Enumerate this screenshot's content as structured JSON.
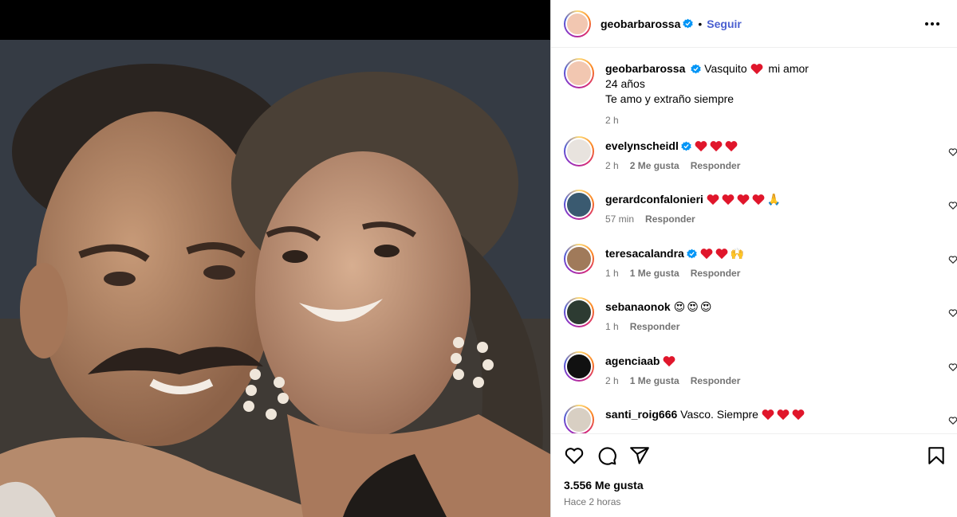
{
  "post": {
    "author": "geobarbarossa",
    "follow_label": "Seguir",
    "separator": "•"
  },
  "caption": {
    "author": "geobarbarossa",
    "line1_a": "Vasquito",
    "line1_b": "mi amor",
    "line2": "24 años",
    "line3": "Te amo y extraño siempre",
    "time": "2 h"
  },
  "comments": [
    {
      "user": "evelynscheidl",
      "verified": true,
      "text": "",
      "hearts": 3,
      "extra_emoji": [],
      "time": "2 h",
      "likes": "2 Me gusta",
      "reply": "Responder"
    },
    {
      "user": "gerardconfalonieri",
      "verified": false,
      "text": "",
      "hearts": 4,
      "extra_emoji": [
        "🙏"
      ],
      "time": "57 min",
      "likes": "",
      "reply": "Responder"
    },
    {
      "user": "teresacalandra",
      "verified": true,
      "text": "",
      "hearts": 2,
      "extra_emoji": [
        "🙌"
      ],
      "time": "1 h",
      "likes": "1 Me gusta",
      "reply": "Responder"
    },
    {
      "user": "sebanaonok",
      "verified": false,
      "text": "",
      "hearts": 0,
      "extra_emoji": [
        "😍",
        "😍",
        "😍"
      ],
      "time": "1 h",
      "likes": "",
      "reply": "Responder"
    },
    {
      "user": "agenciaab",
      "verified": false,
      "text": "",
      "hearts": 1,
      "extra_emoji": [],
      "time": "2 h",
      "likes": "1 Me gusta",
      "reply": "Responder"
    },
    {
      "user": "santi_roig666",
      "verified": false,
      "text": "Vasco. Siempre",
      "hearts": 3,
      "extra_emoji": [],
      "time": "",
      "likes": "",
      "reply": ""
    }
  ],
  "footer": {
    "likes": "3.556 Me gusta",
    "ago": "Hace 2 horas"
  },
  "icons": {
    "like": "heart-icon",
    "comment": "comment-icon",
    "share": "share-icon",
    "save": "bookmark-icon",
    "more": "more-icon",
    "verified": "verified-icon"
  },
  "colors": {
    "accent": "#4a5fd0",
    "verified": "#0095f6",
    "heart": "#e0162b",
    "muted": "#737373"
  }
}
